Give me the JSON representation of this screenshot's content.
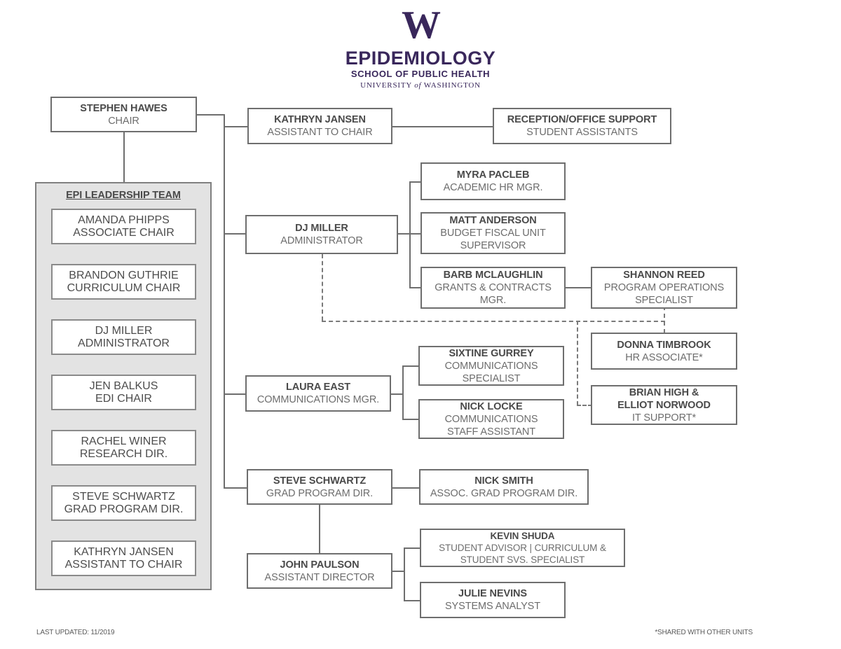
{
  "header": {
    "logo_mark": "uw-w-logo",
    "department": "EPIDEMIOLOGY",
    "school": "SCHOOL OF PUBLIC HEALTH",
    "university_prefix": "UNIVERSITY",
    "university_of": "of",
    "university_suffix": "WASHINGTON",
    "brand_color": "#39275b"
  },
  "chart_meta": {
    "box_border_color": "#6e6e6e",
    "panel_fill_color": "#e3e3e3",
    "text_color": "#4a4a4a",
    "title_text_color": "#6d6d6d"
  },
  "nodes": {
    "chair": {
      "name": "STEPHEN HAWES",
      "title": "CHAIR"
    },
    "assistant_to_chair": {
      "name": "KATHRYN JANSEN",
      "title": "ASSISTANT TO CHAIR"
    },
    "reception": {
      "name": "RECEPTION/OFFICE SUPPORT",
      "title": "STUDENT ASSISTANTS"
    },
    "administrator": {
      "name": "DJ MILLER",
      "title": "ADMINISTRATOR"
    },
    "academic_hr": {
      "name": "MYRA PACLEB",
      "title": "ACADEMIC HR MGR."
    },
    "budget_fiscal": {
      "name": "MATT ANDERSON",
      "title_line1": "BUDGET FISCAL UNIT",
      "title_line2": "SUPERVISOR"
    },
    "grants_contracts": {
      "name": "BARB MCLAUGHLIN",
      "title_line1": "GRANTS & CONTRACTS",
      "title_line2": "MGR."
    },
    "program_ops": {
      "name": "SHANNON REED",
      "title_line1": "PROGRAM OPERATIONS",
      "title_line2": "SPECIALIST"
    },
    "hr_associate": {
      "name": "DONNA TIMBROOK",
      "title": "HR ASSOCIATE*"
    },
    "it_support": {
      "name_line1": "BRIAN HIGH &",
      "name_line2": "ELLIOT NORWOOD",
      "title": "IT SUPPORT*"
    },
    "communications_mgr": {
      "name": "LAURA EAST",
      "title": "COMMUNICATIONS MGR."
    },
    "communications_specialist": {
      "name": "SIXTINE GURREY",
      "title_line1": "COMMUNICATIONS",
      "title_line2": "SPECIALIST"
    },
    "communications_assistant": {
      "name": "NICK LOCKE",
      "title_line1": "COMMUNICATIONS",
      "title_line2": "STAFF ASSISTANT"
    },
    "grad_program_dir": {
      "name": "STEVE SCHWARTZ",
      "title": "GRAD PROGRAM DIR."
    },
    "assoc_grad_program_dir": {
      "name": "NICK SMITH",
      "title": "ASSOC. GRAD PROGRAM DIR."
    },
    "assistant_director": {
      "name": "JOHN PAULSON",
      "title": "ASSISTANT DIRECTOR"
    },
    "student_advisor": {
      "name": "KEVIN SHUDA",
      "title_line1": "STUDENT ADVISOR | CURRICULUM &",
      "title_line2": "STUDENT SVS. SPECIALIST"
    },
    "systems_analyst": {
      "name": "JULIE NEVINS",
      "title": "SYSTEMS ANALYST"
    }
  },
  "leadership_team": {
    "heading": "EPI LEADERSHIP TEAM",
    "members": [
      {
        "name": "AMANDA PHIPPS",
        "title": "ASSOCIATE CHAIR"
      },
      {
        "name": "BRANDON GUTHRIE",
        "title": "CURRICULUM CHAIR"
      },
      {
        "name": "DJ MILLER",
        "title": "ADMINISTRATOR"
      },
      {
        "name": "JEN BALKUS",
        "title": "EDI CHAIR"
      },
      {
        "name": "RACHEL WINER",
        "title": "RESEARCH DIR."
      },
      {
        "name": "STEVE SCHWARTZ",
        "title": "GRAD PROGRAM DIR."
      },
      {
        "name": "KATHRYN JANSEN",
        "title": "ASSISTANT TO CHAIR"
      }
    ]
  },
  "footer": {
    "last_updated": "LAST UPDATED: 11/2019",
    "shared_note": "*SHARED WITH OTHER UNITS"
  }
}
